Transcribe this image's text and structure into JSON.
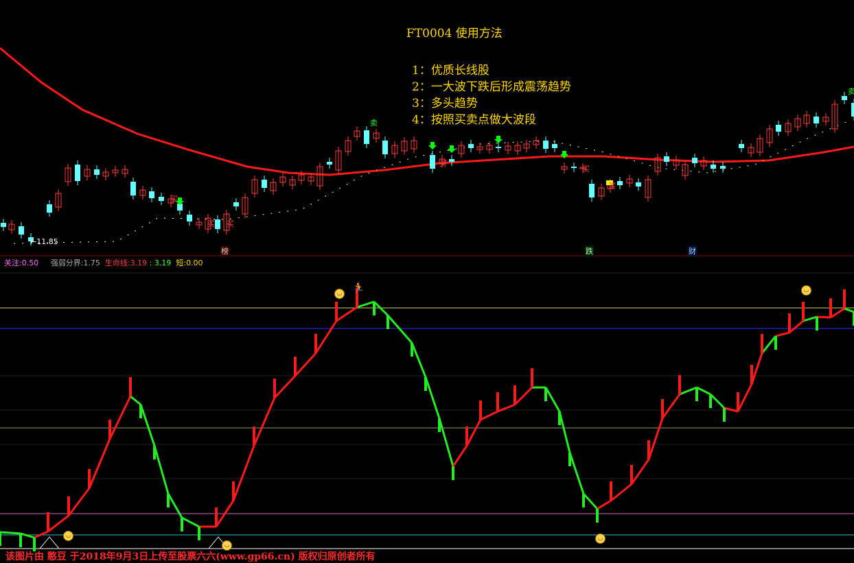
{
  "header": {
    "title": "FT0004   使用方法",
    "notes": [
      "1：优质长线股",
      "2：一大波下跌后形成震荡趋势",
      "3：多头趋势",
      "4：按照买卖点做大波段"
    ]
  },
  "price_panel": {
    "low_label": "←11.85",
    "events": [
      {
        "text": "榜",
        "color": "#ffcc99"
      },
      {
        "text": "跌",
        "color": "#aaffaa"
      },
      {
        "text": "财",
        "color": "#aaccff"
      }
    ],
    "buy_marker": "买",
    "sell_marker": "卖"
  },
  "indicator_bar": {
    "focus_label": "关注:",
    "focus_value": "0.50",
    "strength_label": "强弱分界:",
    "strength_value": "1.75",
    "life_label": "生命线:",
    "life_value1": "3.19",
    "life_value2": "3.19",
    "short_label": "短:",
    "short_value": "0.00"
  },
  "footer": {
    "text": "该图片由 憨豆 于2018年9月3日上传至股票六六(www.gp66.cn) 版权归原创者所有"
  },
  "colors": {
    "background": "#000000",
    "up_candle": "#ff3b3b",
    "down_candle": "#66ffff",
    "ma_line": "#ff1a1a",
    "indicator_up": "#ff1a1a",
    "indicator_down": "#22ee22",
    "buy_arrow": "#00ff00",
    "title_text": "#ffd700"
  },
  "icons": [
    "smiley-icon",
    "runner-icon",
    "down-arrow-icon"
  ]
}
